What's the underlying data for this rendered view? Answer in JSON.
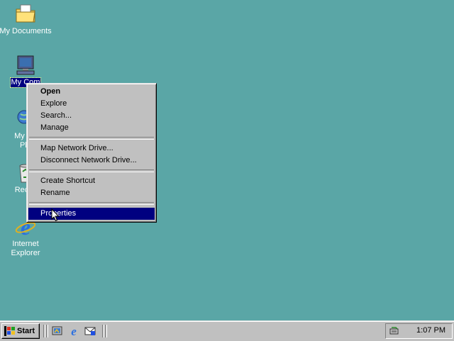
{
  "desktop": {
    "background": "#5aa6a6",
    "icons": [
      {
        "label": "My Documents",
        "icon": "folder-icon"
      },
      {
        "label": "My Com",
        "icon": "computer-icon",
        "selected": true
      },
      {
        "label_line1": "My Ne",
        "label_line2": "Pla",
        "icon": "network-icon"
      },
      {
        "label": "Recyc",
        "icon": "recycle-bin-icon"
      },
      {
        "label_line1": "Internet",
        "label_line2": "Explorer",
        "icon": "ie-icon"
      }
    ]
  },
  "context_menu": {
    "items": [
      {
        "label": "Open",
        "default": true
      },
      {
        "label": "Explore"
      },
      {
        "label": "Search..."
      },
      {
        "label": "Manage"
      },
      {
        "label": "Map Network Drive..."
      },
      {
        "label": "Disconnect Network Drive..."
      },
      {
        "label": "Create Shortcut"
      },
      {
        "label": "Rename"
      },
      {
        "label": "Properties",
        "highlighted": true
      }
    ]
  },
  "taskbar": {
    "start_label": "Start",
    "quick_launch": [
      "desktop-icon",
      "ie-icon",
      "outlook-icon"
    ],
    "clock": "1:07 PM"
  }
}
